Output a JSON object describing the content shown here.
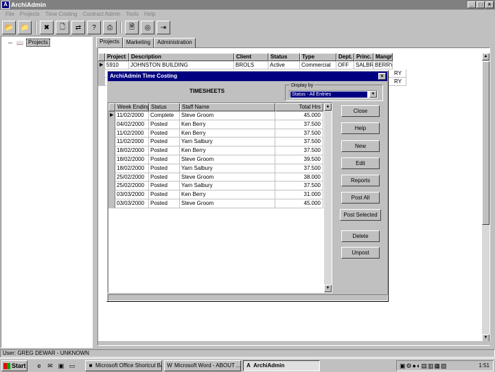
{
  "app": {
    "title": "ArchiAdmin"
  },
  "menu": [
    "File",
    "Projects",
    "Time Costing",
    "Contract Admin",
    "Tools",
    "Help"
  ],
  "toolbar_icons": [
    "open-folder-icon",
    "folder-arrow-icon",
    "erase-icon",
    "new-document-icon",
    "transfer-icon",
    "help-pointer-icon",
    "print-icon",
    "report-icon",
    "globe-icon",
    "export-icon"
  ],
  "tree": {
    "root_label": "Projects"
  },
  "tabs": [
    "Projects",
    "Marketing",
    "Administration"
  ],
  "projects_grid": {
    "columns": [
      "Project",
      "Description",
      "Client",
      "Status",
      "Type",
      "Dept.",
      "Princ.",
      "Mangr"
    ],
    "rows": [
      [
        "5910",
        "JOHNSTON BUILDING",
        "BROLS",
        "Active",
        "Commercial",
        "OFF",
        "SALBRY",
        "BERRY"
      ]
    ],
    "clip_row2_end": "RY",
    "clip_row3_end": "RY"
  },
  "dialog": {
    "title": "ArchiAdmin Time Costing",
    "heading": "TIMESHEETS",
    "display_by_label": "Display by",
    "display_by_value": "Status - All Entries",
    "columns": [
      "Week Ending",
      "Status",
      "Staff Name",
      "Total Hrs"
    ],
    "rows": [
      [
        "11/02/2000",
        "Complete",
        "Steve Groom",
        "45.000"
      ],
      [
        "04/02/2000",
        "Posted",
        "Ken Berry",
        "37.500"
      ],
      [
        "11/02/2000",
        "Posted",
        "Ken Berry",
        "37.500"
      ],
      [
        "11/02/2000",
        "Posted",
        "Yarn Salbury",
        "37.500"
      ],
      [
        "18/02/2000",
        "Posted",
        "Ken Berry",
        "37.500"
      ],
      [
        "18/02/2000",
        "Posted",
        "Steve Groom",
        "39.500"
      ],
      [
        "18/02/2000",
        "Posted",
        "Yarn Salbury",
        "37.500"
      ],
      [
        "25/02/2000",
        "Posted",
        "Steve Groom",
        "38.000"
      ],
      [
        "25/02/2000",
        "Posted",
        "Yarn Salbury",
        "37.500"
      ],
      [
        "03/03/2000",
        "Posted",
        "Ken Berry",
        "31.000"
      ],
      [
        "03/03/2000",
        "Posted",
        "Steve Groom",
        "45.000"
      ]
    ],
    "buttons": {
      "close": "Close",
      "help": "Help",
      "new": "New",
      "edit": "Edit",
      "reports": "Reports",
      "post_all": "Post All",
      "post_selected": "Post  Selected",
      "delete": "Delete",
      "unpost": "Unpost"
    }
  },
  "status_bar": {
    "user": "User: GREG DEWAR - UNKNOWN"
  },
  "taskbar": {
    "start": "Start",
    "tasks": [
      "Microsoft Office Shortcut Bar",
      "Microsoft Word - ABOUT ...",
      "ArchiAdmin"
    ],
    "clock": "1:51"
  }
}
